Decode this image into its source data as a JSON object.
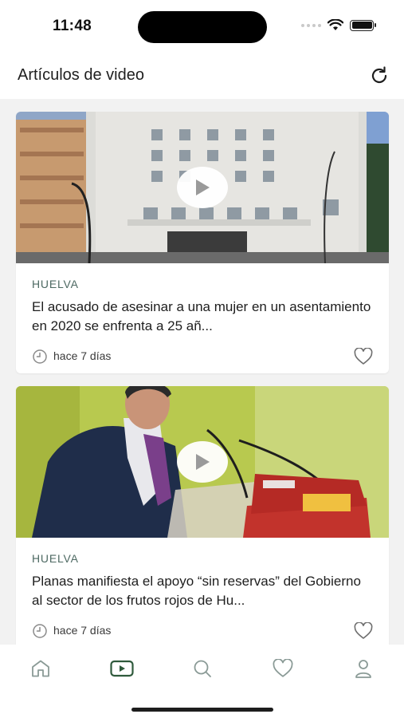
{
  "status_bar": {
    "time": "11:48"
  },
  "header": {
    "title": "Artículos de video"
  },
  "articles": [
    {
      "category": "HUELVA",
      "title": "El acusado de asesinar a una mujer en un asentamiento en 2020 se enfrenta a 25 añ...",
      "date": "hace 7 días"
    },
    {
      "category": "HUELVA",
      "title": "Planas manifiesta el apoyo “sin reservas” del Gobierno al sector de los frutos rojos de Hu...",
      "date": "hace 7 días"
    }
  ],
  "tab_bar": {
    "active": "videos",
    "tabs": [
      "home-icon",
      "video-play-icon",
      "search-icon",
      "heart-icon",
      "user-icon"
    ]
  },
  "colors": {
    "accent": "#2f5a3c",
    "category": "#4e6a63",
    "inactive_icon": "#8a9a96",
    "background": "#f2f2f2"
  }
}
